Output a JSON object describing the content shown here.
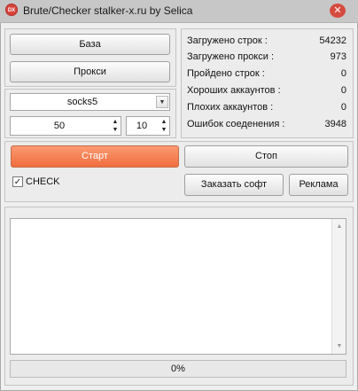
{
  "window": {
    "title": "Brute/Checker stalker-x.ru by Selica",
    "icon_text": "DX"
  },
  "buttons": {
    "base": "База",
    "proxy": "Прокси",
    "start": "Старт",
    "stop": "Стоп",
    "order": "Заказать софт",
    "ads": "Реклама"
  },
  "proxy_type": {
    "selected": "socks5"
  },
  "threads": {
    "value": "50"
  },
  "timeout": {
    "value": "10"
  },
  "check": {
    "label": "CHECK",
    "checked": true
  },
  "stats": [
    {
      "label": "Загружено строк :",
      "value": "54232"
    },
    {
      "label": "Загружено прокси :",
      "value": "973"
    },
    {
      "label": "Пройдено строк :",
      "value": "0"
    },
    {
      "label": "Хороших аккаунтов :",
      "value": "0"
    },
    {
      "label": "Плохих аккаунтов :",
      "value": "0"
    },
    {
      "label": "Ошибок соеденения :",
      "value": "3948"
    }
  ],
  "progress": {
    "text": "0%",
    "value": 0
  },
  "icons": {
    "app": "app-logo-icon",
    "close": "close-icon",
    "dropdown": "chevron-down-icon",
    "spin_up": "spin-up-icon",
    "spin_down": "spin-down-icon",
    "check": "checkmark-icon"
  }
}
